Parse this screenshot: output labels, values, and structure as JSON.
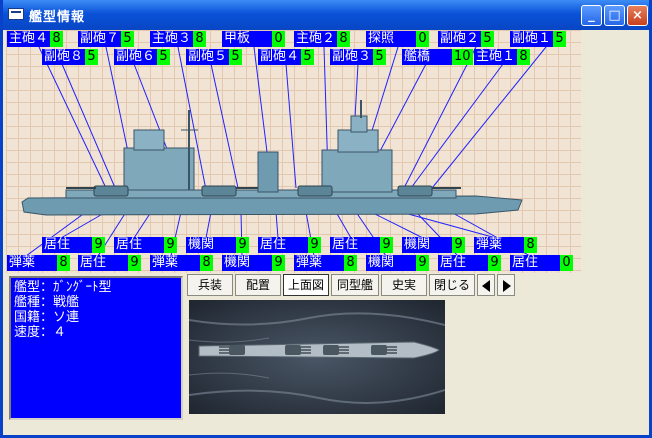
{
  "window": {
    "title": "艦型情報",
    "minimize": "_",
    "maximize": "□",
    "close": "×"
  },
  "top_labels_row1": [
    {
      "name": "主砲４",
      "value": "8"
    },
    {
      "name": "副砲７",
      "value": "5"
    },
    {
      "name": "主砲３",
      "value": "8"
    },
    {
      "name": "甲板",
      "value": "0"
    },
    {
      "name": "主砲２",
      "value": "8"
    },
    {
      "name": "探照",
      "value": "0"
    },
    {
      "name": "副砲２",
      "value": "5"
    },
    {
      "name": "副砲１",
      "value": "5"
    }
  ],
  "top_labels_row2": [
    {
      "name": "副砲８",
      "value": "5"
    },
    {
      "name": "副砲６",
      "value": "5"
    },
    {
      "name": "副砲５",
      "value": "5"
    },
    {
      "name": "副砲４",
      "value": "5"
    },
    {
      "name": "副砲３",
      "value": "5"
    },
    {
      "name": "艦橋",
      "value": "10"
    },
    {
      "name": "主砲１",
      "value": "8"
    }
  ],
  "bottom_labels_row1": [
    {
      "name": "居住",
      "value": "9"
    },
    {
      "name": "居住",
      "value": "9"
    },
    {
      "name": "機関",
      "value": "9"
    },
    {
      "name": "居住",
      "value": "9"
    },
    {
      "name": "居住",
      "value": "9"
    },
    {
      "name": "機関",
      "value": "9"
    },
    {
      "name": "弾薬",
      "value": "8"
    }
  ],
  "bottom_labels_row2": [
    {
      "name": "弾薬",
      "value": "8"
    },
    {
      "name": "居住",
      "value": "9"
    },
    {
      "name": "弾薬",
      "value": "8"
    },
    {
      "name": "機関",
      "value": "9"
    },
    {
      "name": "弾薬",
      "value": "8"
    },
    {
      "name": "機関",
      "value": "9"
    },
    {
      "name": "居住",
      "value": "9"
    },
    {
      "name": "居住",
      "value": "0"
    }
  ],
  "info": {
    "line1": "艦型：ｶﾞﾝｸﾞｰﾄ型",
    "line2": "艦種：戦艦",
    "line3": "国籍：ソ連",
    "line4": "速度：４"
  },
  "tabs": [
    {
      "label": "兵装"
    },
    {
      "label": "配置"
    },
    {
      "label": "上面図"
    },
    {
      "label": "同型艦"
    },
    {
      "label": "史実"
    },
    {
      "label": "閉じる"
    }
  ],
  "colors": {
    "label_bg": "#0000ff",
    "value_bg": "#00ff00",
    "hull": "#6f9bb0",
    "leader_line": "#2020ff"
  }
}
